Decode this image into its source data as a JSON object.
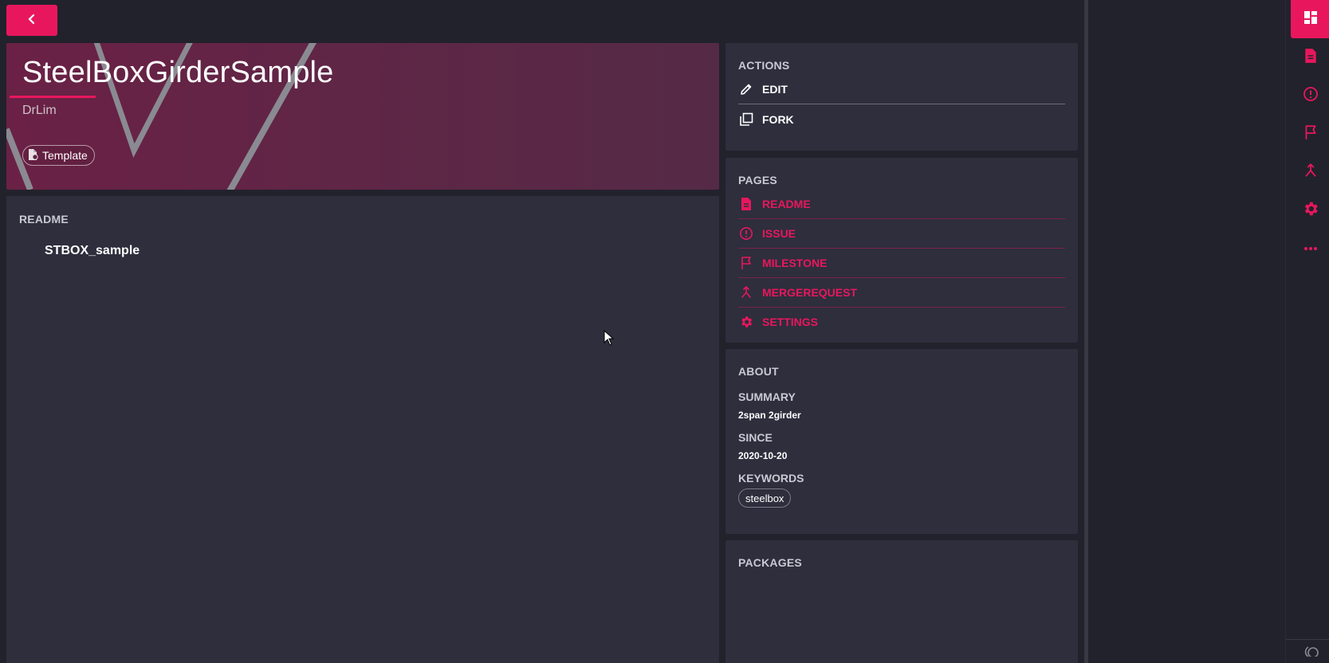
{
  "header": {
    "back_icon": "chevron-left-icon"
  },
  "project": {
    "title": "SteelBoxGirderSample",
    "owner": "DrLim",
    "template_chip": "Template"
  },
  "readme": {
    "heading": "README",
    "content": "STBOX_sample"
  },
  "actions": {
    "heading": "ACTIONS",
    "items": [
      {
        "label": "EDIT",
        "icon": "pencil-icon"
      },
      {
        "label": "FORK",
        "icon": "copy-icon"
      }
    ]
  },
  "pages": {
    "heading": "PAGES",
    "items": [
      {
        "label": "README",
        "icon": "document-icon"
      },
      {
        "label": "ISSUE",
        "icon": "alert-circle-icon"
      },
      {
        "label": "MILESTONE",
        "icon": "flag-icon"
      },
      {
        "label": "MERGEREQUEST",
        "icon": "merge-icon"
      },
      {
        "label": "SETTINGS",
        "icon": "gear-icon"
      }
    ]
  },
  "about": {
    "heading": "ABOUT",
    "summary_label": "SUMMARY",
    "summary_value": "2span 2girder",
    "since_label": "SINCE",
    "since_value": "2020-10-20",
    "keywords_label": "KEYWORDS",
    "keywords": [
      "steelbox"
    ]
  },
  "packages": {
    "heading": "PACKAGES"
  },
  "colors": {
    "accent": "#e8175d",
    "background": "#22222c",
    "card": "#2e2e3d",
    "hero": "#5d2746"
  },
  "rail": {
    "items": [
      "dashboard-icon",
      "document-icon",
      "alert-circle-icon",
      "flag-icon",
      "merge-icon",
      "gear-icon",
      "more-icon"
    ]
  }
}
